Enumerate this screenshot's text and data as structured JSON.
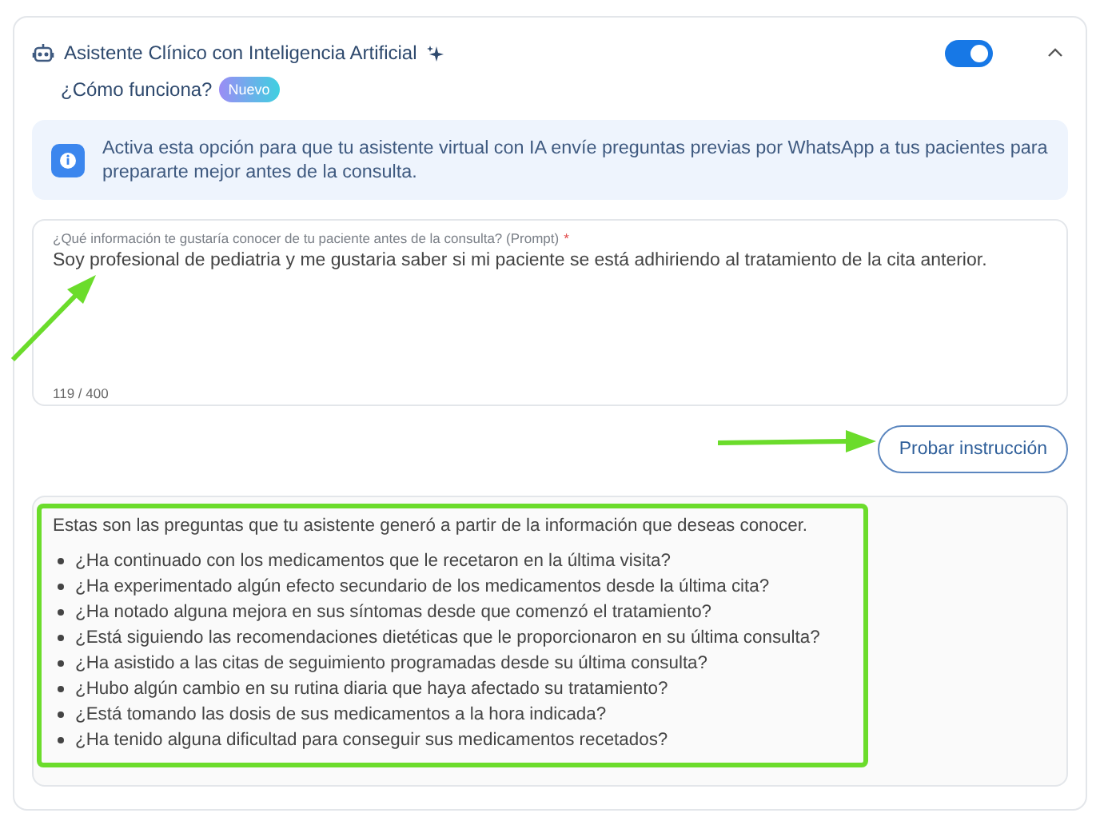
{
  "assistant": {
    "title": "Asistente Clínico con Inteligencia Artificial",
    "enabled": true,
    "expanded": true
  },
  "how_it_works": {
    "link": "¿Cómo funciona?",
    "badge": "Nuevo"
  },
  "info": {
    "text": "Activa esta opción para que tu asistente virtual con IA envíe preguntas previas por WhatsApp a tus pacientes para prepararte mejor antes de la consulta."
  },
  "prompt": {
    "label": "¿Qué información te gustaría conocer de tu paciente antes de la consulta? (Prompt)",
    "required_mark": "*",
    "value": "Soy profesional de pediatria y me gustaria saber si mi paciente se está adhiriendo al tratamiento de la cita anterior.",
    "counter": "119 / 400"
  },
  "test_button": "Probar instrucción",
  "results": {
    "intro": "Estas son las preguntas que tu asistente generó a partir de la información que deseas conocer.",
    "questions": [
      "¿Ha continuado con los medicamentos que le recetaron en la última visita?",
      "¿Ha experimentado algún efecto secundario de los medicamentos desde la última cita?",
      "¿Ha notado alguna mejora en sus síntomas desde que comenzó el tratamiento?",
      "¿Está siguiendo las recomendaciones dietéticas que le proporcionaron en su última consulta?",
      "¿Ha asistido a las citas de seguimiento programadas desde su última consulta?",
      "¿Hubo algún cambio en su rutina diaria que haya afectado su tratamiento?",
      "¿Está tomando las dosis de sus medicamentos a la hora indicada?",
      "¿Ha tenido alguna dificultad para conseguir sus medicamentos recetados?"
    ]
  }
}
